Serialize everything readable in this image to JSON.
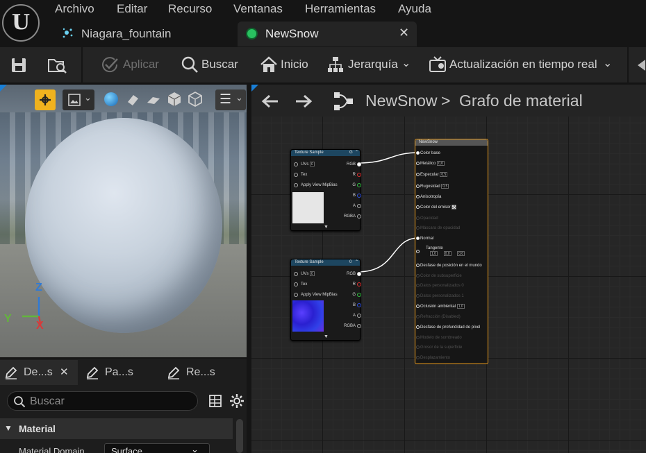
{
  "menu": {
    "items": [
      "Archivo",
      "Editar",
      "Recurso",
      "Ventanas",
      "Herramientas",
      "Ayuda"
    ]
  },
  "tabs": [
    {
      "label": "Niagara_fountain"
    },
    {
      "label": "NewSnow",
      "close": "✕"
    }
  ],
  "toolbar": {
    "apply_label": "Aplicar",
    "search_label": "Buscar",
    "home_label": "Inicio",
    "hierarchy_label": "Jerarquía",
    "realtime_label": "Actualización en tiempo real"
  },
  "viewport": {
    "axis_z": "Z",
    "axis_y": "Y",
    "axis_x": "X"
  },
  "details": {
    "tabs": [
      {
        "label": "De...s",
        "close": "✕"
      },
      {
        "label": "Pa...s"
      },
      {
        "label": "Re...s"
      }
    ],
    "search_placeholder": "Buscar",
    "section": "Material",
    "prop_label": "Material Domain",
    "prop_value": "Surface"
  },
  "graph": {
    "breadcrumb_root": "NewSnow",
    "breadcrumb_sep": ">",
    "breadcrumb_leaf": "Grafo de material",
    "texture_nodes": [
      {
        "title": "Texture Sample",
        "badge": "G",
        "uvs_label": "UVs",
        "uvs_value": "0",
        "tex_label": "Tex",
        "mip_label": "Apply View MipBias",
        "outputs": [
          "RGB",
          "R",
          "G",
          "B",
          "A",
          "RGBA"
        ]
      },
      {
        "title": "Texture Sample",
        "badge": "0",
        "uvs_label": "UVs",
        "uvs_value": "0",
        "tex_label": "Tex",
        "mip_label": "Apply View MipBias",
        "outputs": [
          "RGB",
          "R",
          "G",
          "B",
          "A",
          "RGBA"
        ]
      }
    ],
    "result_node": {
      "title": "NewSnow",
      "pins": [
        {
          "label": "Color base",
          "active": true
        },
        {
          "label": "Metálico",
          "value": "0,0",
          "active": true
        },
        {
          "label": "Especular",
          "value": "0,5",
          "active": true
        },
        {
          "label": "Rugosidad",
          "value": "0,5",
          "active": true
        },
        {
          "label": "Anisotropía",
          "active": true
        },
        {
          "label": "Color del emisor",
          "active": true
        },
        {
          "label": "Opacidad",
          "active": false
        },
        {
          "label": "Máscara de opacidad",
          "active": false
        },
        {
          "label": "Normal",
          "active": true
        },
        {
          "label": "Tangente",
          "x": "1,0",
          "y": "0,0",
          "z": "0,0",
          "active": true
        },
        {
          "label": "Desfase de posición en el mundo",
          "active": true
        },
        {
          "label": "Color de subsuperficie",
          "active": false
        },
        {
          "label": "Datos personalizados 0",
          "active": false
        },
        {
          "label": "Datos personalizados 1",
          "active": false
        },
        {
          "label": "Oclusión ambiental",
          "value": "1,0",
          "active": true
        },
        {
          "label": "Refracción (Disabled)",
          "active": false
        },
        {
          "label": "Desfase de profundidad de píxel",
          "active": true
        },
        {
          "label": "Modelo de sombreado",
          "active": false
        },
        {
          "label": "Grosor de la superficie",
          "active": false
        },
        {
          "label": "Desplazamiento",
          "active": false
        }
      ]
    }
  },
  "colors": {
    "accent_orange": "#f2a11d",
    "node_header_blue": "#1d4660",
    "pin_red": "#e03030",
    "pin_green": "#30c040",
    "pin_blue": "#3050e0"
  }
}
